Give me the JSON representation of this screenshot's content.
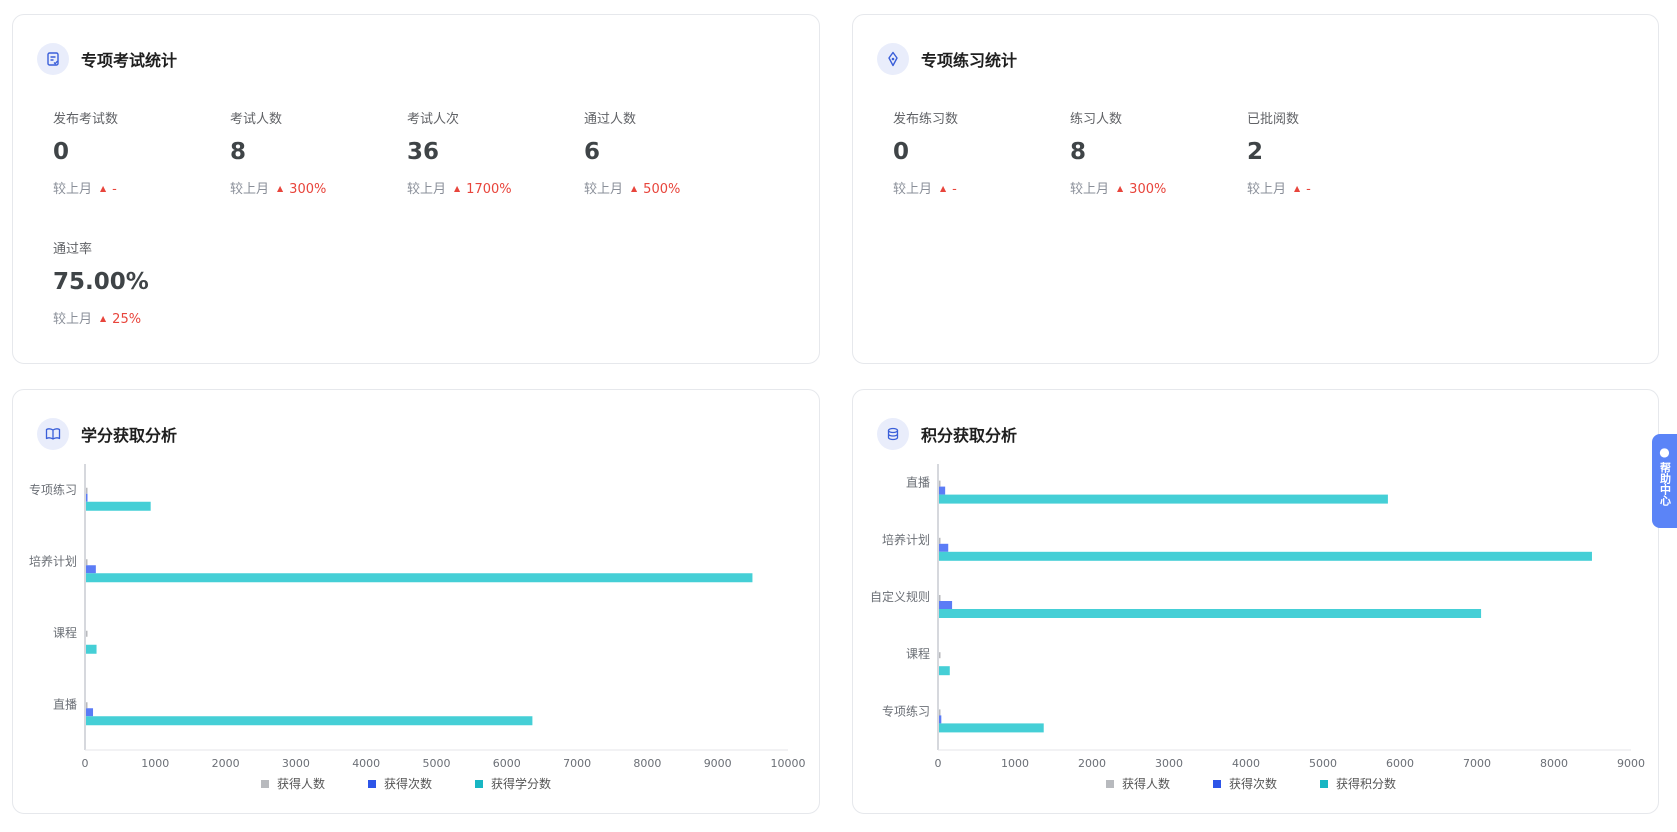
{
  "exam_card": {
    "title": "专项考试统计",
    "compare_label": "较上月",
    "stats": [
      {
        "label": "发布考试数",
        "value": "0",
        "delta": "-"
      },
      {
        "label": "考试人数",
        "value": "8",
        "delta": "300%"
      },
      {
        "label": "考试人次",
        "value": "36",
        "delta": "1700%"
      },
      {
        "label": "通过人数",
        "value": "6",
        "delta": "500%"
      },
      {
        "label": "通过率",
        "value": "75.00%",
        "delta": "25%"
      }
    ]
  },
  "practice_card": {
    "title": "专项练习统计",
    "compare_label": "较上月",
    "stats": [
      {
        "label": "发布练习数",
        "value": "0",
        "delta": "-"
      },
      {
        "label": "练习人数",
        "value": "8",
        "delta": "300%"
      },
      {
        "label": "已批阅数",
        "value": "2",
        "delta": "-"
      }
    ]
  },
  "credit_card": {
    "title": "学分获取分析"
  },
  "points_card": {
    "title": "积分获取分析"
  },
  "help": {
    "label": "帮助中心"
  },
  "colors": {
    "people": "#b8babe",
    "times": "#5b7cf6",
    "value": "#45cfd6",
    "up": "#e8453c"
  },
  "chart_data": [
    {
      "type": "bar",
      "orientation": "horizontal",
      "categories": [
        "专项练习",
        "培养计划",
        "课程",
        "直播"
      ],
      "series": [
        {
          "name": "获得人数",
          "values": [
            4,
            8,
            2,
            6
          ]
        },
        {
          "name": "获得次数",
          "values": [
            20,
            140,
            0,
            100
          ]
        },
        {
          "name": "获得学分数",
          "values": [
            920,
            9480,
            150,
            6350
          ]
        }
      ],
      "xlim": [
        0,
        10000
      ],
      "xticks": [
        "0",
        "1000",
        "2000",
        "3000",
        "4000",
        "5000",
        "6000",
        "7000",
        "8000",
        "9000",
        "10000"
      ],
      "legend_position": "bottom"
    },
    {
      "type": "bar",
      "orientation": "horizontal",
      "categories": [
        "直播",
        "培养计划",
        "自定义规则",
        "课程",
        "专项练习"
      ],
      "series": [
        {
          "name": "获得人数",
          "values": [
            6,
            8,
            10,
            2,
            4
          ]
        },
        {
          "name": "获得次数",
          "values": [
            80,
            120,
            170,
            0,
            30
          ]
        },
        {
          "name": "获得积分数",
          "values": [
            5830,
            8480,
            7040,
            140,
            1360
          ]
        }
      ],
      "xlim": [
        0,
        9000
      ],
      "xticks": [
        "0",
        "1000",
        "2000",
        "3000",
        "4000",
        "5000",
        "6000",
        "7000",
        "8000",
        "9000"
      ],
      "legend_position": "bottom"
    }
  ]
}
